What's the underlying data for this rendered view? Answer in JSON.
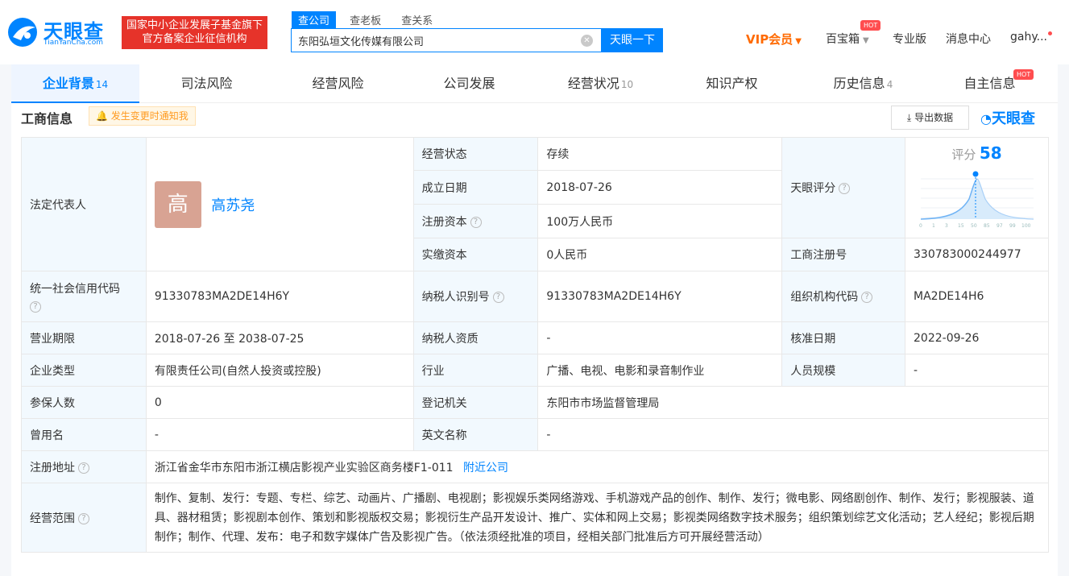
{
  "header": {
    "logo_text": "天眼查",
    "logo_sub": "TianYanCha.com",
    "banner_line1": "国家中小企业发展子基金旗下",
    "banner_line2": "官方备案企业征信机构",
    "search_tabs": [
      "查公司",
      "查老板",
      "查关系"
    ],
    "search_value": "东阳弘垣文化传媒有限公司",
    "search_button": "天眼一下",
    "vip": "VIP会员",
    "treasure": "百宝箱",
    "hot": "HOT",
    "pro": "专业版",
    "messages": "消息中心",
    "user": "gahy..."
  },
  "tabs": [
    {
      "label": "企业背景",
      "count": "14"
    },
    {
      "label": "司法风险",
      "count": ""
    },
    {
      "label": "经营风险",
      "count": ""
    },
    {
      "label": "公司发展",
      "count": ""
    },
    {
      "label": "经营状况",
      "count": "10"
    },
    {
      "label": "知识产权",
      "count": ""
    },
    {
      "label": "历史信息",
      "count": "4"
    },
    {
      "label": "自主信息",
      "count": ""
    }
  ],
  "section": {
    "title": "工商信息",
    "notify": "发生变更时通知我",
    "export": "导出数据",
    "brand": "天眼查"
  },
  "info": {
    "legal_rep_label": "法定代表人",
    "legal_rep_avatar": "高",
    "legal_rep_name": "高苏尧",
    "status_label": "经营状态",
    "status": "存续",
    "found_label": "成立日期",
    "found": "2018-07-26",
    "reg_cap_label": "注册资本",
    "reg_cap": "100万人民币",
    "paid_cap_label": "实缴资本",
    "paid_cap": "0人民币",
    "score_label": "天眼评分",
    "score_title": "评分",
    "score": "58",
    "score_axis": [
      "0",
      "1",
      "3",
      "15",
      "50",
      "85",
      "97",
      "99",
      "100"
    ],
    "reg_no_label": "工商注册号",
    "reg_no": "330783000244977",
    "credit_label": "统一社会信用代码",
    "credit": "91330783MA2DE14H6Y",
    "tax_label": "纳税人识别号",
    "tax": "91330783MA2DE14H6Y",
    "org_label": "组织机构代码",
    "org": "MA2DE14H6",
    "term_label": "营业期限",
    "term": "2018-07-26 至 2038-07-25",
    "tax_qual_label": "纳税人资质",
    "tax_qual": "-",
    "approve_label": "核准日期",
    "approve": "2022-09-26",
    "type_label": "企业类型",
    "type": "有限责任公司(自然人投资或控股)",
    "industry_label": "行业",
    "industry": "广播、电视、电影和录音制作业",
    "staff_label": "人员规模",
    "staff": "-",
    "insured_label": "参保人数",
    "insured": "0",
    "authority_label": "登记机关",
    "authority": "东阳市市场监督管理局",
    "former_label": "曾用名",
    "former": "-",
    "english_label": "英文名称",
    "english": "-",
    "address_label": "注册地址",
    "address": "浙江省金华市东阳市浙江横店影视产业实验区商务楼F1-011",
    "nearby": "附近公司",
    "scope_label": "经营范围",
    "scope": "制作、复制、发行：专题、专栏、综艺、动画片、广播剧、电视剧；影视娱乐类网络游戏、手机游戏产品的创作、制作、发行；微电影、网络剧创作、制作、发行；影视服装、道具、器材租赁；影视剧本创作、策划和影视版权交易；影视衍生产品开发设计、推广、实体和网上交易；影视类网络数字技术服务；组织策划综艺文化活动；艺人经纪；影视后期制作；制作、代理、发布：电子和数字媒体广告及影视广告。（依法须经批准的项目，经相关部门批准后方可开展经营活动）"
  }
}
